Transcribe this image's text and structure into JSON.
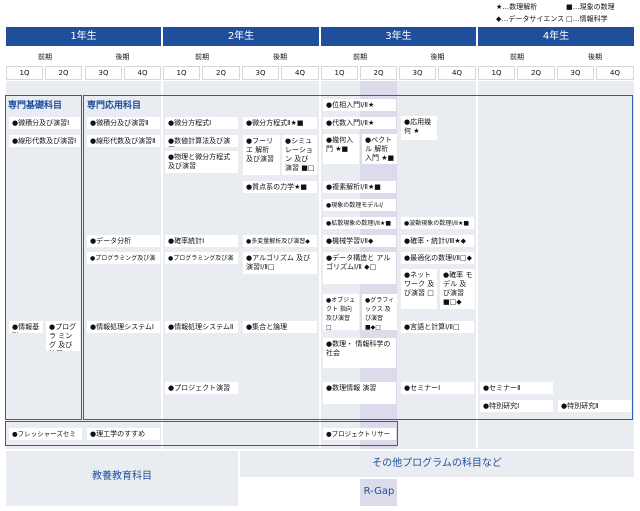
{
  "legend": [
    "★…数理解析",
    "■…現象の数理",
    "◆…データサイエンス",
    "□…情報科学"
  ],
  "years": [
    "1年生",
    "2年生",
    "3年生",
    "4年生"
  ],
  "terms": [
    "前期",
    "後期",
    "前期",
    "後期",
    "前期",
    "後期",
    "前期",
    "後期"
  ],
  "quarters": [
    "1Q",
    "2Q",
    "3Q",
    "4Q",
    "1Q",
    "2Q",
    "3Q",
    "4Q",
    "1Q",
    "2Q",
    "3Q",
    "4Q",
    "1Q",
    "2Q",
    "3Q",
    "4Q"
  ],
  "sections": {
    "basic": "専門基礎科目",
    "applied": "専門応用科目"
  },
  "courses": {
    "c01": "●微積分及び演習Ⅰ",
    "c02": "●線形代数及び演習Ⅰ",
    "c03": "●微積分及び演習Ⅱ",
    "c04": "●線形代数及び演習Ⅱ",
    "c05": "●微分方程式Ⅰ",
    "c06": "●数値計算法及び演習",
    "c07": "●物理と微分方程式 及び演習",
    "c08": "●微分方程式Ⅱ★■",
    "c09": "●フーリエ 解析 及び演習",
    "c10": "●シミュ レーション 及び演習 ■□",
    "c11": "●質点系の力学★■",
    "c12": "●位相入門Ⅰ/Ⅱ★",
    "c13": "●代数入門Ⅰ/Ⅱ★",
    "c14": "●幾何入門 ★■",
    "c15": "●ベクトル 解析入門 ★■",
    "c16": "●応用幾何 ★",
    "c17": "●複素解析Ⅰ/Ⅱ★■",
    "c18": "●現象の数理モデルⅠ/Ⅱ★■",
    "c19": "●拡散現象の数理Ⅰ/Ⅱ★■",
    "c20": "●波動現象の数理Ⅰ/Ⅱ★■",
    "c21": "●データ分析",
    "c22": "●確率統計Ⅰ",
    "c23": "●多変量解析及び演習◆",
    "c24": "●機械学習Ⅰ/Ⅱ◆",
    "c25": "●確率・統計Ⅰ/Ⅲ★◆",
    "c26": "●プログラミング及び演習Ⅱ",
    "c27": "●プログラミング及び演習Ⅲ",
    "c28": "●アルゴリズム 及び演習Ⅰ/Ⅱ□",
    "c29": "●データ構造と アルゴリズムⅠ/Ⅱ ◆□",
    "c30": "●最適化の数理Ⅰ/Ⅱ□◆",
    "c31": "●ネット ワーク 及び演習 □",
    "c32": "●確率 モデル 及び演習 ■□◆",
    "c33": "●オブジェクト 指向 及び演習 □",
    "c34": "●グラフィックス 及び演習 ■◆□",
    "c35": "●情報基礎",
    "c36": "●プログラ ミング 及び演習Ⅰ",
    "c37": "●情報処理システムⅠ",
    "c38": "●情報処理システムⅡ",
    "c39": "●集合と論理",
    "c40": "●言語と計算Ⅰ/Ⅱ□",
    "c41": "●数理・ 情報科学の 社会",
    "c42": "●プロジェクト演習",
    "c43": "●数理情報 演習",
    "c44": "●セミナーⅠ",
    "c45": "●セミナーⅡ",
    "c46": "●特別研究Ⅰ",
    "c47": "●特別研究Ⅱ",
    "c48": "●フレッシャーズセミナー",
    "c49": "●理工学のすすめ",
    "c50": "●プロジェクトリサーチⅠ"
  },
  "bottom": {
    "general": "教養教育科目",
    "other": "その他プログラムの科目など",
    "rgap": "R-Gap"
  }
}
